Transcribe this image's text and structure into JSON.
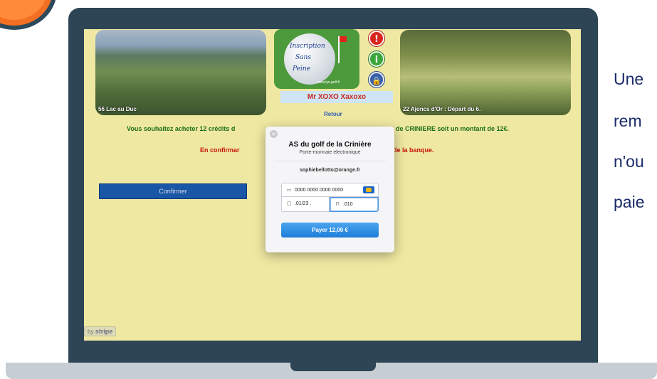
{
  "site": {
    "photos": {
      "left_caption": "56 Lac au Duc",
      "right_caption": "22 Ajoncs d'Or : Départ du 6."
    },
    "logo": {
      "line1": "Inscription",
      "line2": "Sans",
      "line3": "Peine",
      "url": "www.isp-golf.fr"
    },
    "icons": {
      "exit": "exit-icon",
      "info": "info-icon",
      "lock": "lock-icon"
    },
    "user_name": "Mr XOXO Xaxoxo",
    "retour_label": "Retour",
    "message_green_part1": "Vous souhaitez acheter 12 crédits d",
    "message_green_part2": "de CRINIERE soit un montant de 12€.",
    "message_red_part1": "En confirmar",
    "message_red_part2": "de la banque.",
    "confirm_label": "Confirmer",
    "stripe_badge_prefix": "by",
    "stripe_badge_brand": "stripe"
  },
  "checkout": {
    "merchant": "AS du golf de la Crinière",
    "subtitle": "Porte-monnaie electronique",
    "email": "sophiebellotto@orange.fr",
    "card_number": "0000 0000 0000 0000",
    "expiry": ".01/23 .",
    "cvc": ".010",
    "pay_label": "Payer 12,00 €",
    "close_glyph": "×"
  },
  "side_text": {
    "line1": "Une",
    "line2": "rem",
    "line3": "n'ou",
    "line4": "paie"
  },
  "colors": {
    "page_bg": "#efe8a2",
    "bezel": "#2d4555",
    "confirm_button": "#1a56a6",
    "pay_button": "#2b8ae0"
  }
}
